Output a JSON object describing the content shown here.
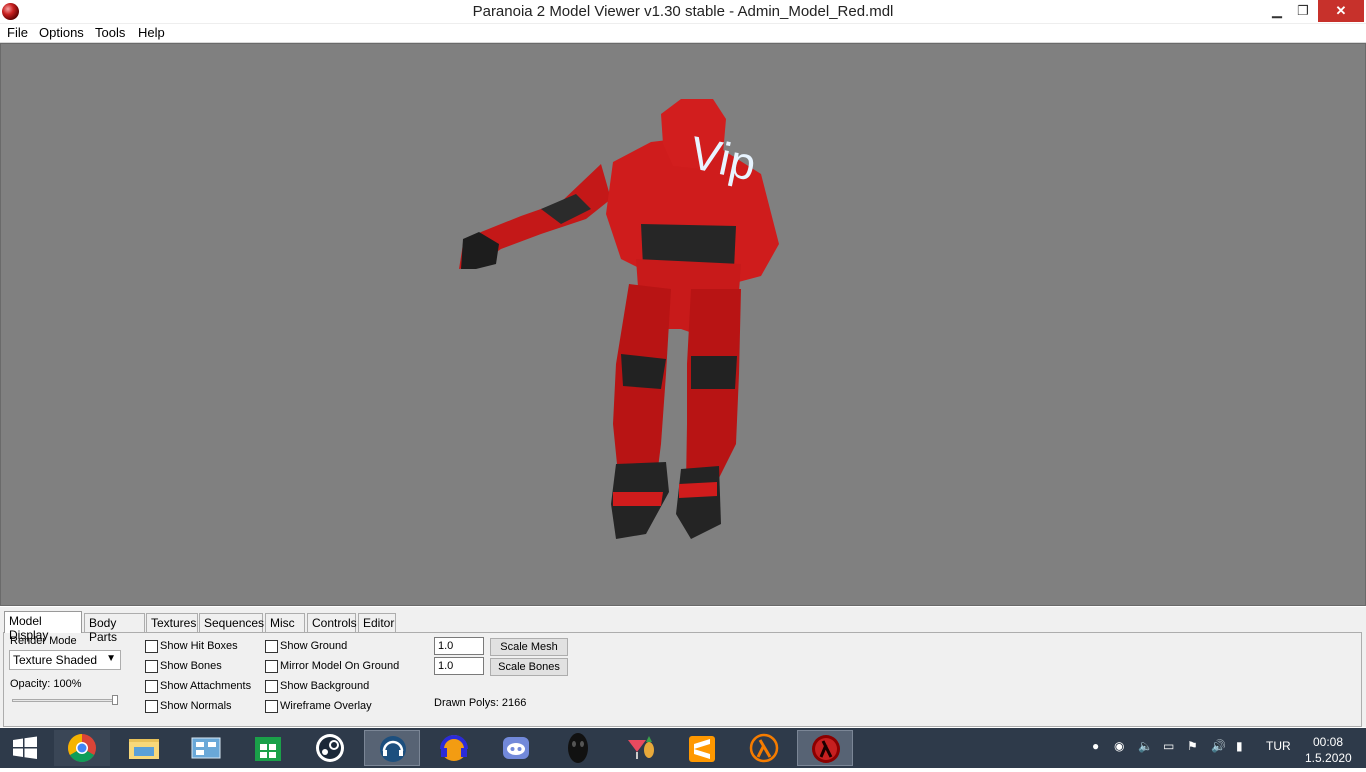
{
  "window": {
    "title": "Paranoia 2 Model Viewer v1.30 stable - Admin_Model_Red.mdl",
    "minimize": "▁",
    "maximize": "❐",
    "close": "✕"
  },
  "menu": [
    "File",
    "Options",
    "Tools",
    "Help"
  ],
  "viewport": {
    "background": "#808080",
    "decal_text": "Vip"
  },
  "tabs": [
    "Model Display",
    "Body Parts",
    "Textures",
    "Sequences",
    "Misc",
    "Controls",
    "Editor"
  ],
  "model_display": {
    "render_mode_label": "Render Mode",
    "render_mode_value": "Texture Shaded",
    "opacity_label": "Opacity: 100%",
    "opacity_value": 100,
    "checkboxes_col1": [
      "Show Hit Boxes",
      "Show Bones",
      "Show Attachments",
      "Show Normals"
    ],
    "checkboxes_col2": [
      "Show Ground",
      "Mirror Model On Ground",
      "Show Background",
      "Wireframe Overlay"
    ],
    "scale_mesh_value": "1.0",
    "scale_mesh_button": "Scale Mesh",
    "scale_bones_value": "1.0",
    "scale_bones_button": "Scale Bones",
    "drawn_polys": "Drawn Polys: 2166"
  },
  "taskbar": {
    "apps": [
      "windows-start",
      "chrome",
      "file-explorer",
      "control-panel",
      "store",
      "steam",
      "teamspeak",
      "audacity",
      "discord",
      "mask-app",
      "game-app",
      "sublime-text",
      "half-life",
      "paranoia-model-viewer"
    ],
    "language": "TUR",
    "time": "00:08",
    "date": "1.5.2020"
  }
}
